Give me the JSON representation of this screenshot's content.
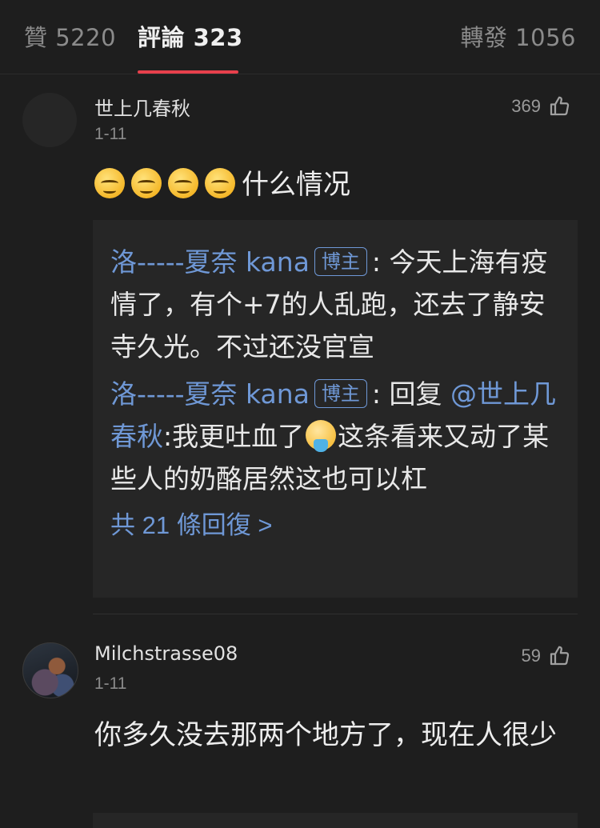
{
  "tabs": {
    "likes": "贊 5220",
    "comments": "評論 323",
    "reposts": "轉發 1056"
  },
  "comments": [
    {
      "username": "世上几春秋",
      "date": "1-11",
      "likes": "369",
      "text": "什么情况",
      "emoji_count": 4,
      "replies": [
        {
          "name": "洛-----夏奈 kana",
          "badge": "博主",
          "sep": ":",
          "text": " 今天上海有疫情了，有个+7的人乱跑，还去了静安寺久光。不过还没官宣"
        },
        {
          "name": "洛-----夏奈 kana",
          "badge": "博主",
          "sep": ":",
          "prefix": " 回复 ",
          "mention": "@世上几春秋",
          "text_a": ":我更吐血了",
          "text_b": "这条看来又动了某些人的奶酪居然这也可以杠"
        }
      ],
      "more_replies": "共 21 條回復 >"
    },
    {
      "username": "Milchstrasse08",
      "date": "1-11",
      "likes": "59",
      "text": "你多久没去那两个地方了，现在人很少"
    }
  ],
  "icons": {
    "like": "thumbs-up-icon",
    "emoji": "squinting-face-emoji",
    "emoji_vomit": "vomiting-face-emoji"
  },
  "colors": {
    "accent": "#e8404c",
    "link": "#6f98d6",
    "background": "#1e1e1e"
  }
}
